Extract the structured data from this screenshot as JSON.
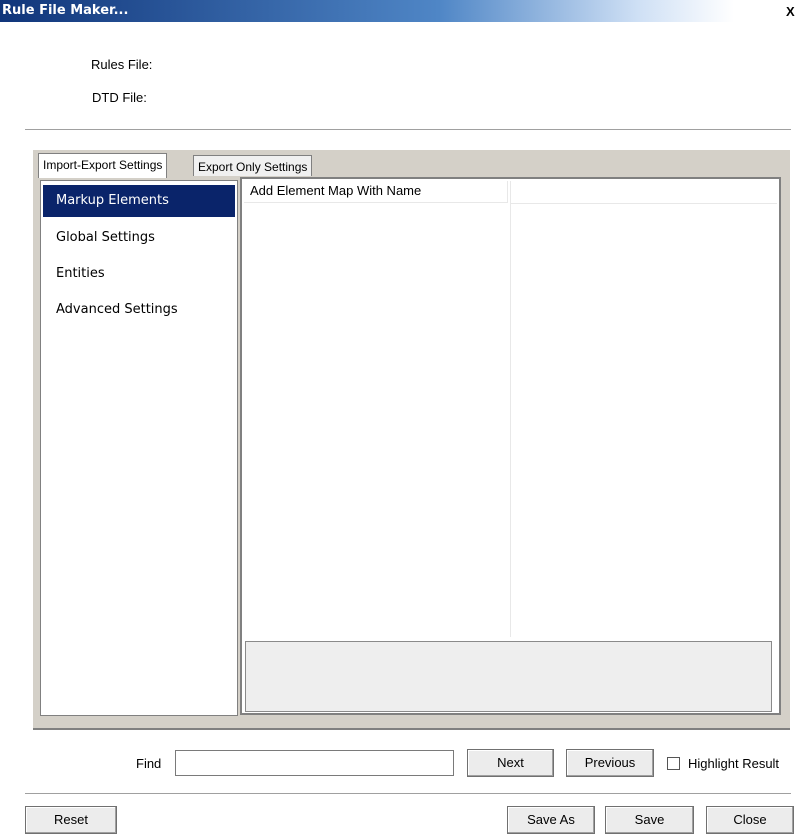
{
  "window": {
    "title": "Rule File Maker...",
    "close_label": "X"
  },
  "files": {
    "rules_label": "Rules File:",
    "dtd_label": "DTD File:"
  },
  "tabs": [
    {
      "label": "Import-Export Settings",
      "active": true
    },
    {
      "label": "Export Only Settings",
      "active": false
    }
  ],
  "sidebar": {
    "items": [
      {
        "label": "Markup Elements",
        "selected": true
      },
      {
        "label": "Global Settings",
        "selected": false
      },
      {
        "label": "Entities",
        "selected": false
      },
      {
        "label": "Advanced Settings",
        "selected": false
      }
    ]
  },
  "grid": {
    "header": "Add Element Map With Name",
    "header2": ""
  },
  "find": {
    "label": "Find",
    "value": "",
    "next_label": "Next",
    "previous_label": "Previous",
    "highlight_label": "Highlight Result",
    "highlight_checked": false
  },
  "footer": {
    "reset_label": "Reset",
    "save_as_label": "Save As",
    "save_label": "Save",
    "close_label": "Close"
  },
  "colors": {
    "selection": "#0a246a",
    "panel": "#d4d0c8",
    "title_start": "#10357a"
  }
}
